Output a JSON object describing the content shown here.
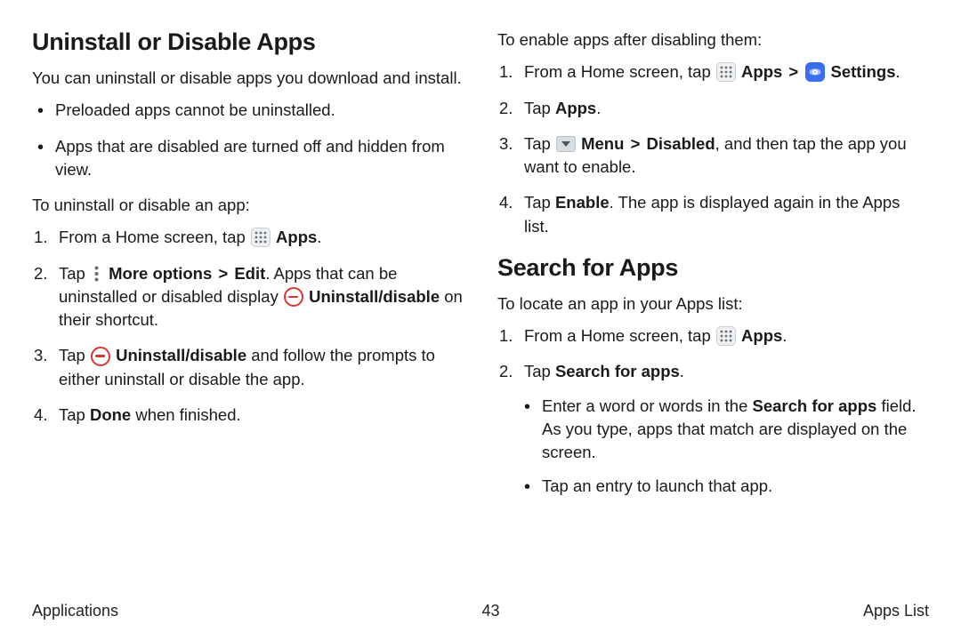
{
  "left": {
    "heading": "Uninstall or Disable Apps",
    "intro": "You can uninstall or disable apps you download and install.",
    "bullets": [
      "Preloaded apps cannot be uninstalled.",
      "Apps that are disabled are turned off and hidden from view."
    ],
    "lead1": "To uninstall or disable an app:",
    "steps1": {
      "s1a": "From a Home screen, tap ",
      "s1b": "Apps",
      "s1c": ".",
      "s2a": "Tap ",
      "s2b": "More options",
      "s2c": "Edit",
      "s2d": ". Apps that can be uninstalled or disabled display ",
      "s2e": "Uninstall/disable",
      "s2f": " on their shortcut.",
      "s3a": "Tap ",
      "s3b": "Uninstall/disable",
      "s3c": " and follow the prompts to either uninstall or disable the app.",
      "s4a": "Tap ",
      "s4b": "Done",
      "s4c": " when finished."
    }
  },
  "right": {
    "lead2": "To enable apps after disabling them:",
    "steps2": {
      "s1a": "From a Home screen, tap ",
      "s1b": "Apps",
      "s1c": "Settings",
      "s1d": ".",
      "s2a": "Tap ",
      "s2b": "Apps",
      "s2c": ".",
      "s3a": "Tap ",
      "s3b": "Menu",
      "s3c": "Disabled",
      "s3d": ", and then tap the app you want to enable.",
      "s4a": "Tap ",
      "s4b": "Enable",
      "s4c": ". The app is displayed again in the Apps list."
    },
    "heading2": "Search for Apps",
    "intro2": "To locate an app in your Apps list:",
    "steps3": {
      "s1a": "From a Home screen, tap ",
      "s1b": "Apps",
      "s1c": ".",
      "s2a": "Tap ",
      "s2b": "Search for apps",
      "s2c": ".",
      "sub1a": "Enter a word or words in the ",
      "sub1b": "Search for apps",
      "sub1c": " field. As you type, apps that match are displayed on the screen.",
      "sub2": "Tap an entry to launch that app."
    }
  },
  "glyphs": {
    "gt": ">"
  },
  "footer": {
    "left": "Applications",
    "center": "43",
    "right": "Apps List"
  }
}
